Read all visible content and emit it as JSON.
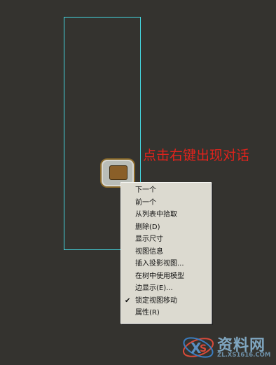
{
  "annotation": {
    "text": "点击右键出现对话"
  },
  "context_menu": {
    "items": [
      {
        "label": "下一个",
        "checked": false
      },
      {
        "label": "前一个",
        "checked": false
      },
      {
        "label": "从列表中拾取",
        "checked": false
      },
      {
        "label": "删除(D)",
        "checked": false
      },
      {
        "label": "显示尺寸",
        "checked": false
      },
      {
        "label": "视图信息",
        "checked": false
      },
      {
        "label": "插入投影视图...",
        "checked": false
      },
      {
        "label": "在树中使用模型",
        "checked": false
      },
      {
        "label": "边显示(E)...",
        "checked": false
      },
      {
        "label": "锁定视图移动",
        "checked": true
      },
      {
        "label": "属性(R)",
        "checked": false
      }
    ]
  },
  "watermark": {
    "title": "资料网",
    "url": "ZL.XS1616.COM"
  },
  "colors": {
    "frame": "#44d6e0",
    "annotation": "#e0231c",
    "menu_bg": "#dcdad0"
  }
}
